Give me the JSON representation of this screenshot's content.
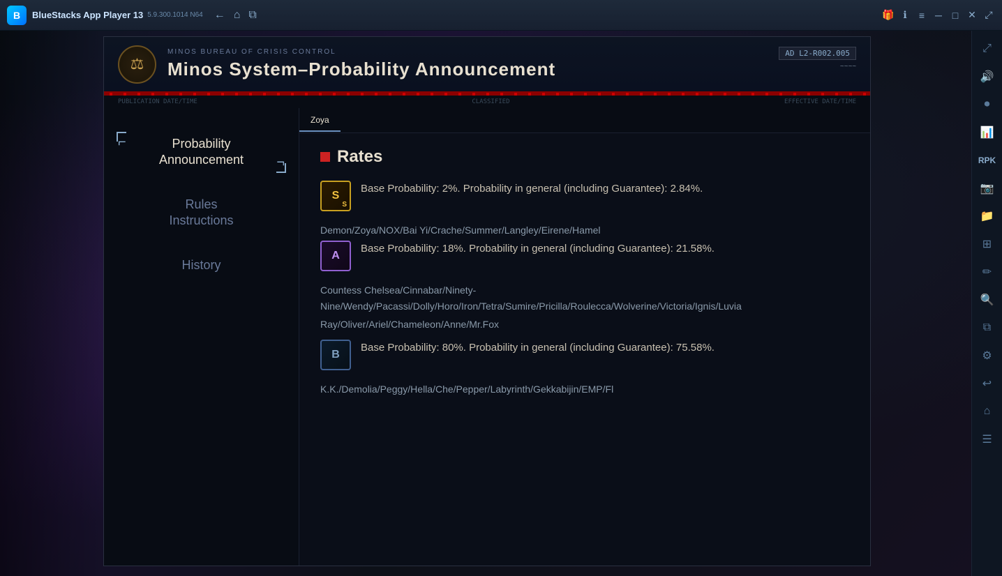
{
  "titlebar": {
    "app_name": "BlueStacks App Player 13",
    "version": "5.9.300.1014  N64",
    "nav_back": "←",
    "nav_home": "⌂",
    "nav_tabs": "⧉",
    "gift_icon": "🎁",
    "info_icon": "ℹ",
    "menu_icon": "≡",
    "minimize_icon": "─",
    "maximize_icon": "□",
    "close_icon": "✕",
    "expand_icon": "⤢"
  },
  "document": {
    "org_name": "MINOS BUREAU OF CRISIS CONTROL",
    "title": "Minos System–Probability Announcement",
    "doc_id": "AD L2-R002.005",
    "meta_left": "PUBLICATION DATE/TIME",
    "meta_center": "CLASSIFIED",
    "meta_right": "EFFECTIVE DATE/TIME"
  },
  "nav": {
    "items": [
      {
        "id": "probability",
        "label": "Probability\nAnnouncement",
        "active": true
      },
      {
        "id": "rules",
        "label": "Rules\nInstructions",
        "active": false
      },
      {
        "id": "history",
        "label": "History",
        "active": false
      }
    ]
  },
  "char_tab": {
    "name": "Zoya"
  },
  "rates_section": {
    "title": "Rates",
    "s_rank": {
      "label": "S",
      "text": "Base Probability: 2%. Probability in general (including Guarantee): 2.84%."
    },
    "a_rank": {
      "label": "A",
      "char_list": "Demon/Zoya/NOX/Bai Yi/Crache/Summer/Langley/Eirene/Hamel",
      "text": "Base Probability: 18%. Probability in general (including Guarantee): 21.58%."
    },
    "b_rank": {
      "label": "B",
      "char_list_1": "Countess Chelsea/Cinnabar/Ninety-Nine/Wendy/Pacassi/Dolly/Horo/Iron/Tetra/Sumire/Pricilla/Roulecca/Wolverine/Victoria/Ignis/Luvia",
      "char_list_2": "Ray/Oliver/Ariel/Chameleon/Anne/Mr.Fox",
      "text": "Base Probability: 80%. Probability in general (including Guarantee): 75.58%."
    },
    "b_rank_extra": "K.K./Demolia/Peggy/Hella/Che/Pepper/Labyrinth/Gekkabijin/EMP/Fl"
  },
  "right_sidebar": {
    "icons": [
      {
        "name": "expand-icon",
        "symbol": "⤢"
      },
      {
        "name": "speaker-icon",
        "symbol": "🔊"
      },
      {
        "name": "record-icon",
        "symbol": "⏺"
      },
      {
        "name": "performance-icon",
        "symbol": "📊"
      },
      {
        "name": "rpk-icon",
        "symbol": "⚡"
      },
      {
        "name": "camera-icon",
        "symbol": "📷"
      },
      {
        "name": "folder-icon",
        "symbol": "📁"
      },
      {
        "name": "layout-icon",
        "symbol": "⊞"
      },
      {
        "name": "edit-icon",
        "symbol": "✏"
      },
      {
        "name": "search-icon",
        "symbol": "🔍"
      },
      {
        "name": "layers-icon",
        "symbol": "⧉"
      },
      {
        "name": "settings-icon",
        "symbol": "⚙"
      },
      {
        "name": "back-icon",
        "symbol": "↩"
      },
      {
        "name": "home-icon",
        "symbol": "⌂"
      },
      {
        "name": "options-icon",
        "symbol": "☰"
      }
    ]
  }
}
